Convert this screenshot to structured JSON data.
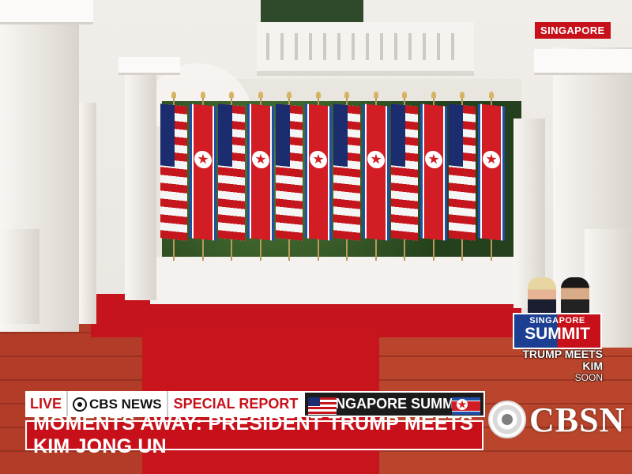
{
  "broadcast": {
    "location_badge": "SINGAPORE",
    "promo": {
      "title_top": "SINGAPORE",
      "title_main": "SUMMIT",
      "subtitle": "TRUMP MEETS KIM",
      "timing": "SOON"
    },
    "lower_third": {
      "live_label": "LIVE",
      "network_label": "CBS NEWS",
      "report_label": "SPECIAL REPORT",
      "event_label": "SINGAPORE SUMMIT",
      "headline": "MOMENTS AWAY: PRESIDENT TRUMP MEETS KIM JONG UN"
    },
    "channel_logo_text": "CBSN"
  },
  "scene": {
    "flags": [
      "us-flag",
      "nk-flag",
      "us-flag",
      "nk-flag",
      "us-flag",
      "nk-flag",
      "us-flag",
      "nk-flag",
      "us-flag",
      "nk-flag",
      "us-flag",
      "nk-flag"
    ],
    "colors": {
      "carpet": "#c8141c",
      "alert_red": "#c8101a",
      "navy": "#1b2d6e"
    }
  }
}
